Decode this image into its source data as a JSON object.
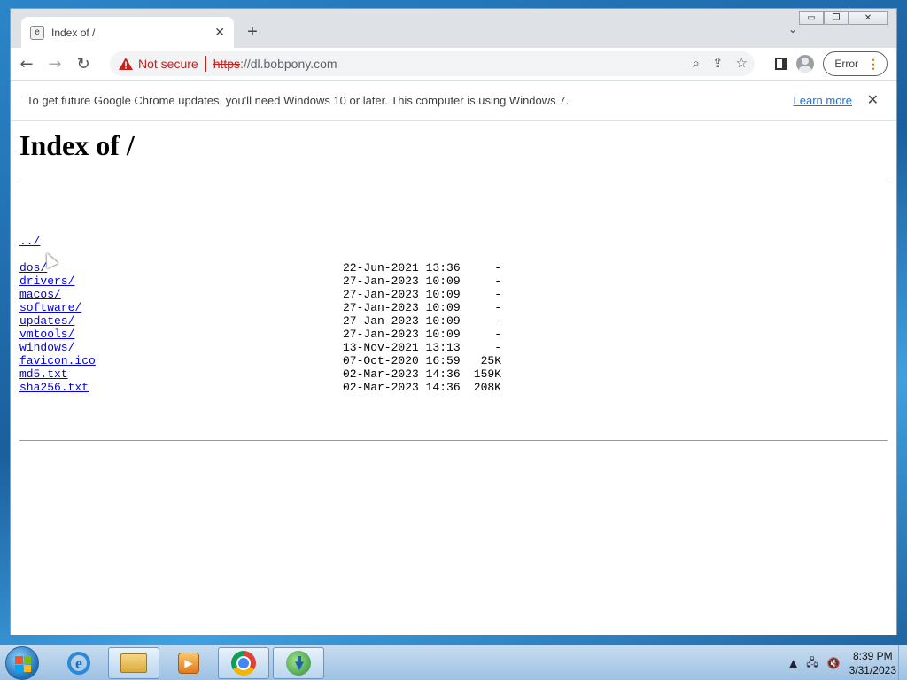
{
  "window_controls": {
    "minimize": "▭",
    "maximize": "❐",
    "close": "✕"
  },
  "tab": {
    "title": "Index of /",
    "close": "✕"
  },
  "toolbar": {
    "not_secure": "Not secure",
    "url_scheme": "https",
    "url_rest": "://dl.bobpony.com",
    "error_label": "Error"
  },
  "infobar": {
    "message": "To get future Google Chrome updates, you'll need Windows 10 or later. This computer is using Windows 7.",
    "learn_more": "Learn more"
  },
  "page": {
    "heading": "Index of /",
    "parent_link": "../",
    "entries": [
      {
        "name": "dos/",
        "date": "22-Jun-2021 13:36",
        "size": "-"
      },
      {
        "name": "drivers/",
        "date": "27-Jan-2023 10:09",
        "size": "-"
      },
      {
        "name": "macos/",
        "date": "27-Jan-2023 10:09",
        "size": "-"
      },
      {
        "name": "software/",
        "date": "27-Jan-2023 10:09",
        "size": "-"
      },
      {
        "name": "updates/",
        "date": "27-Jan-2023 10:09",
        "size": "-"
      },
      {
        "name": "vmtools/",
        "date": "27-Jan-2023 10:09",
        "size": "-"
      },
      {
        "name": "windows/",
        "date": "13-Nov-2021 13:13",
        "size": "-"
      },
      {
        "name": "favicon.ico",
        "date": "07-Oct-2020 16:59",
        "size": "25K"
      },
      {
        "name": "md5.txt",
        "date": "02-Mar-2023 14:36",
        "size": "159K"
      },
      {
        "name": "sha256.txt",
        "date": "02-Mar-2023 14:36",
        "size": "208K"
      }
    ]
  },
  "taskbar": {
    "clock_time": "8:39 PM",
    "clock_date": "3/31/2023",
    "apps": [
      "internet-explorer-icon",
      "file-explorer-icon",
      "media-player-icon",
      "chrome-icon",
      "download-manager-icon"
    ]
  }
}
